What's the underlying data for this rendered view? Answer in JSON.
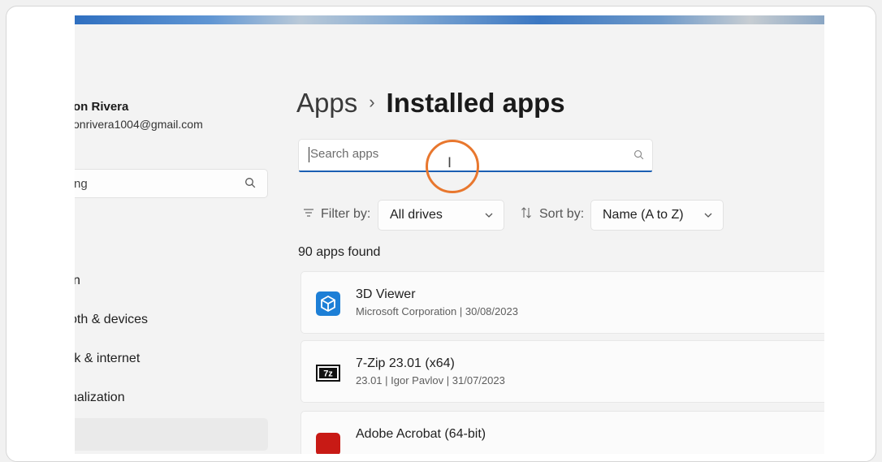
{
  "sidebar": {
    "user_name": "on Rivera",
    "user_email": "onrivera1004@gmail.com",
    "search_text": "ng",
    "items": [
      {
        "label": "n"
      },
      {
        "label": "oth & devices"
      },
      {
        "label": "rk & internet"
      },
      {
        "label": "nalization"
      }
    ]
  },
  "breadcrumb": {
    "parent": "Apps",
    "separator": "›",
    "current": "Installed apps"
  },
  "search": {
    "placeholder": "Search apps",
    "value": ""
  },
  "filter": {
    "label": "Filter by:",
    "value": "All drives"
  },
  "sort": {
    "label": "Sort by:",
    "value": "Name (A to Z)"
  },
  "results_count": "90 apps found",
  "apps": [
    {
      "name": "3D Viewer",
      "meta": "Microsoft Corporation  |  30/08/2023",
      "icon": "3d-viewer-icon"
    },
    {
      "name": "7-Zip 23.01 (x64)",
      "meta": "23.01  |  Igor Pavlov  |  31/07/2023",
      "icon": "7zip-icon"
    },
    {
      "name": "Adobe Acrobat (64-bit)",
      "meta": "",
      "icon": "adobe-acrobat-icon"
    }
  ],
  "colors": {
    "accent": "#1b5fb3",
    "highlight_ring": "#e8772e"
  }
}
